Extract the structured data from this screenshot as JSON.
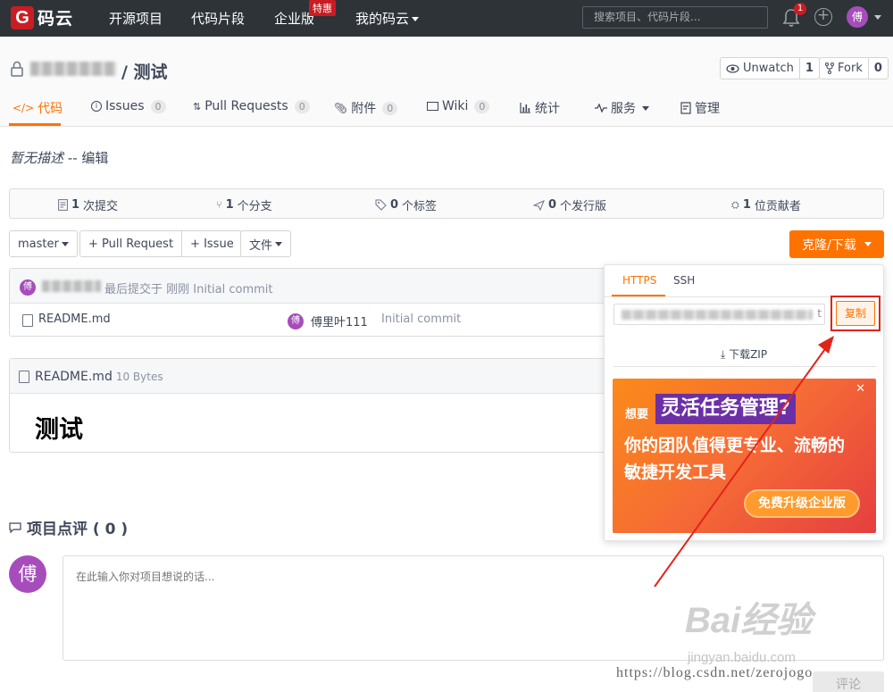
{
  "topnav": {
    "logo_glyph": "G",
    "logo_text": "码云",
    "items": [
      "开源项目",
      "代码片段",
      "企业版",
      "我的码云"
    ],
    "enterprise_badge": "特惠",
    "search_placeholder": "搜索项目、代码片段...",
    "notifications": "1",
    "avatar": "傅"
  },
  "repo": {
    "title": "/ 测试",
    "watch_label": "Unwatch",
    "watch_count": "1",
    "fork_label": "Fork",
    "fork_count": "0"
  },
  "tabs": [
    {
      "label": "代码",
      "count": ""
    },
    {
      "label": "Issues",
      "count": "0"
    },
    {
      "label": "Pull Requests",
      "count": "0"
    },
    {
      "label": "附件",
      "count": "0"
    },
    {
      "label": "Wiki",
      "count": "0"
    },
    {
      "label": "统计",
      "count": ""
    },
    {
      "label": "服务",
      "count": ""
    },
    {
      "label": "管理",
      "count": ""
    }
  ],
  "description": {
    "text": "暂无描述",
    "sep": " -- ",
    "edit": "编辑"
  },
  "stats": {
    "commits_num": "1",
    "commits_label": "次提交",
    "branches_num": "1",
    "branches_label": "个分支",
    "tags_num": "0",
    "tags_label": "个标签",
    "releases_num": "0",
    "releases_label": "个发行版",
    "contributors_num": "1",
    "contributors_label": "位贡献者"
  },
  "actions": {
    "branch": "master",
    "pull_request": "+ Pull Request",
    "issue": "+ Issue",
    "files": "文件",
    "clone": "克隆/下载"
  },
  "commit": {
    "avatar": "傅",
    "text": "最后提交于 刚刚 Initial commit"
  },
  "files": [
    {
      "name": "README.md",
      "author_avatar": "傅",
      "author": "傅里叶111",
      "message": "Initial commit"
    }
  ],
  "readme": {
    "title": "README.md",
    "size": "10 Bytes",
    "heading": "测试"
  },
  "comments": {
    "title": "项目点评 ( 0 )",
    "avatar": "傅",
    "placeholder": "在此输入你对项目想说的话...",
    "submit": "评论"
  },
  "clone_panel": {
    "tab_https": "HTTPS",
    "tab_ssh": "SSH",
    "url_suffix": "t",
    "copy": "复制",
    "zip": "下载ZIP",
    "ad": {
      "prefix": "想要",
      "headline": "灵活任务管理?",
      "line1": "你的团队值得更专业、流畅的",
      "line2": "敏捷开发工具",
      "button": "免费升级企业版"
    }
  },
  "watermark": {
    "baidu": "Bai经验",
    "baidu_url": "jingyan.baidu.com",
    "csdn": "https://blog.csdn.net/zerojogo"
  },
  "colors": {
    "accent": "#fe7300",
    "nav_bg": "#2e3338",
    "brand_red": "#c71d23",
    "avatar_purple": "#a64dbb",
    "annotation_red": "#e2231a"
  }
}
